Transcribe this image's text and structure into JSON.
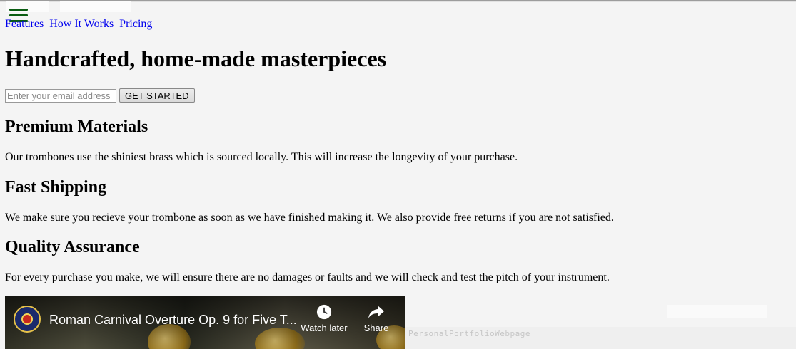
{
  "header": {
    "menu_icon": "hamburger-menu-icon",
    "menu_color": "#0a5c12",
    "nav_links": [
      "Features",
      "How It Works",
      "Pricing"
    ]
  },
  "hero": {
    "title": "Handcrafted, home-made masterpieces",
    "email_placeholder": "Enter your email address",
    "cta_label": "GET STARTED"
  },
  "features": [
    {
      "title": "Premium Materials",
      "text": "Our trombones use the shiniest brass which is sourced locally. This will increase the longevity of your purchase."
    },
    {
      "title": "Fast Shipping",
      "text": "We make sure you recieve your trombone as soon as we have finished making it. We also provide free returns if you are not satisfied."
    },
    {
      "title": "Quality Assurance",
      "text": "For every purchase you make, we will ensure there are no damages or faults and we will check and test the pitch of your instrument."
    }
  ],
  "video": {
    "title": "Roman Carnival Overture Op. 9 for Five T...",
    "watch_later_label": "Watch later",
    "share_label": "Share",
    "watch_later_icon": "clock-icon",
    "share_icon": "share-arrow-icon"
  },
  "overlay": {
    "watermark": "PersonalPortfolioWebpage"
  }
}
